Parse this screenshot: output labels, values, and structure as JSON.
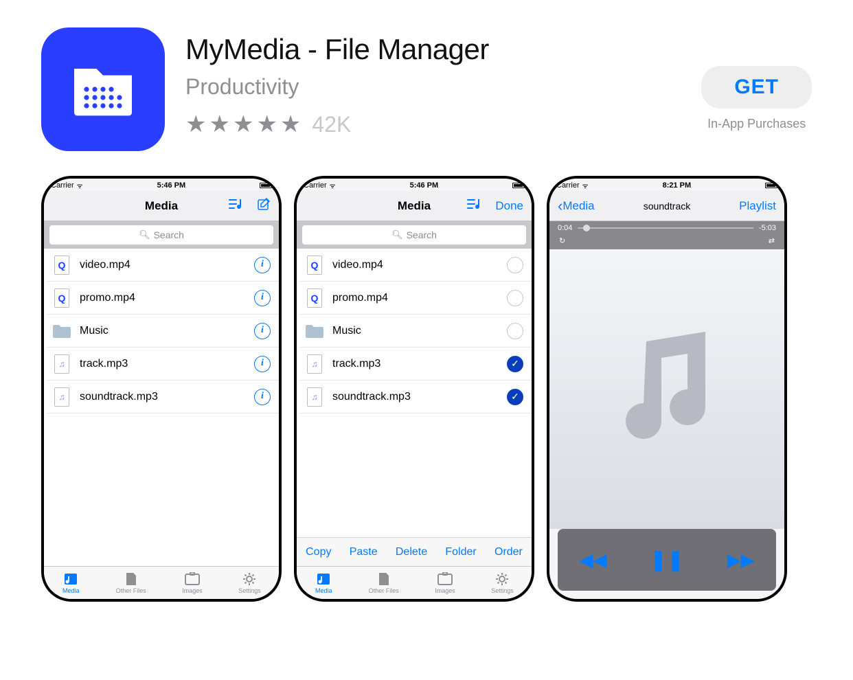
{
  "header": {
    "title": "MyMedia - File Manager",
    "category": "Productivity",
    "rating_count": "42K",
    "get_label": "GET",
    "iap_label": "In-App Purchases"
  },
  "shot1": {
    "status": {
      "carrier": "Carrier",
      "time": "5:46 PM"
    },
    "nav": {
      "title": "Media"
    },
    "search_placeholder": "Search",
    "files": [
      {
        "name": "video.mp4",
        "type": "video"
      },
      {
        "name": "promo.mp4",
        "type": "video"
      },
      {
        "name": "Music",
        "type": "folder"
      },
      {
        "name": "track.mp3",
        "type": "audio"
      },
      {
        "name": "soundtrack.mp3",
        "type": "audio"
      }
    ],
    "tabs": [
      "Media",
      "Other Files",
      "Images",
      "Settings"
    ]
  },
  "shot2": {
    "status": {
      "carrier": "Carrier",
      "time": "5:46 PM"
    },
    "nav": {
      "title": "Media",
      "done": "Done"
    },
    "search_placeholder": "Search",
    "files": [
      {
        "name": "video.mp4",
        "type": "video",
        "checked": false
      },
      {
        "name": "promo.mp4",
        "type": "video",
        "checked": false
      },
      {
        "name": "Music",
        "type": "folder",
        "checked": false
      },
      {
        "name": "track.mp3",
        "type": "audio",
        "checked": true
      },
      {
        "name": "soundtrack.mp3",
        "type": "audio",
        "checked": true
      }
    ],
    "edit_actions": [
      "Copy",
      "Paste",
      "Delete",
      "Folder",
      "Order"
    ],
    "tabs": [
      "Media",
      "Other Files",
      "Images",
      "Settings"
    ]
  },
  "shot3": {
    "status": {
      "carrier": "Carrier",
      "time": "8:21 PM"
    },
    "nav": {
      "back": "Media",
      "title": "soundtrack",
      "right": "Playlist"
    },
    "player": {
      "elapsed": "0:04",
      "remaining": "-5:03"
    }
  }
}
